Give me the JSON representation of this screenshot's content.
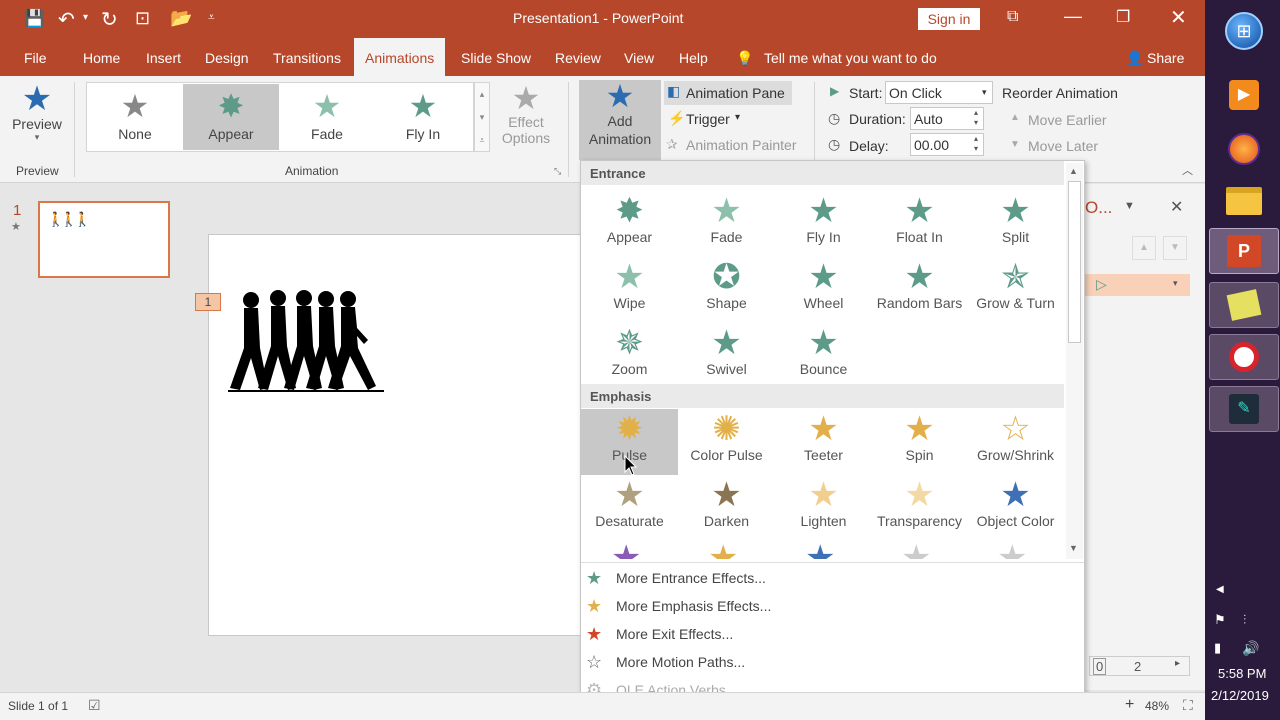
{
  "window": {
    "title": "Presentation1  -  PowerPoint",
    "sign_in": "Sign in"
  },
  "tabs": [
    "File",
    "Home",
    "Insert",
    "Design",
    "Transitions",
    "Animations",
    "Slide Show",
    "Review",
    "View",
    "Help"
  ],
  "tell_me": "Tell me what you want to do",
  "share": "Share",
  "ribbon": {
    "preview": {
      "label": "Preview",
      "group": "Preview"
    },
    "animation_group": "Animation",
    "gallery": [
      "None",
      "Appear",
      "Fade",
      "Fly In"
    ],
    "effect_options": [
      "Effect",
      "Options"
    ],
    "add_animation": [
      "Add",
      "Animation"
    ],
    "animation_pane": "Animation Pane",
    "trigger": "Trigger",
    "animation_painter": "Animation Painter",
    "start_label": "Start:",
    "start_value": "On Click",
    "duration_label": "Duration:",
    "duration_value": "Auto",
    "delay_label": "Delay:",
    "delay_value": "00.00",
    "reorder": "Reorder Animation",
    "move_earlier": "Move Earlier",
    "move_later": "Move Later"
  },
  "slide_panel": {
    "number": "1"
  },
  "slide": {
    "anim_tag": "1"
  },
  "pane": {
    "title_partial": "O..."
  },
  "dropdown": {
    "entrance_header": "Entrance",
    "entrance": [
      "Appear",
      "Fade",
      "Fly In",
      "Float In",
      "Split",
      "Wipe",
      "Shape",
      "Wheel",
      "Random Bars",
      "Grow & Turn",
      "Zoom",
      "Swivel",
      "Bounce"
    ],
    "emphasis_header": "Emphasis",
    "emphasis": [
      "Pulse",
      "Color Pulse",
      "Teeter",
      "Spin",
      "Grow/Shrink",
      "Desaturate",
      "Darken",
      "Lighten",
      "Transparency",
      "Object Color"
    ],
    "more": [
      "More Entrance Effects...",
      "More Emphasis Effects...",
      "More Exit Effects...",
      "More Motion Paths...",
      "OLE Action Verbs..."
    ]
  },
  "status": {
    "slide_info": "Slide 1 of 1",
    "zoom": "48%",
    "timeline_zero": "0",
    "timeline_two": "2"
  },
  "clock": {
    "time": "5:58 PM",
    "date": "2/12/2019"
  },
  "colors": {
    "accent": "#b7472a",
    "entrance_star": "#5d9b88",
    "emphasis_star": "#e2b04a",
    "exit_star": "#d24726"
  }
}
